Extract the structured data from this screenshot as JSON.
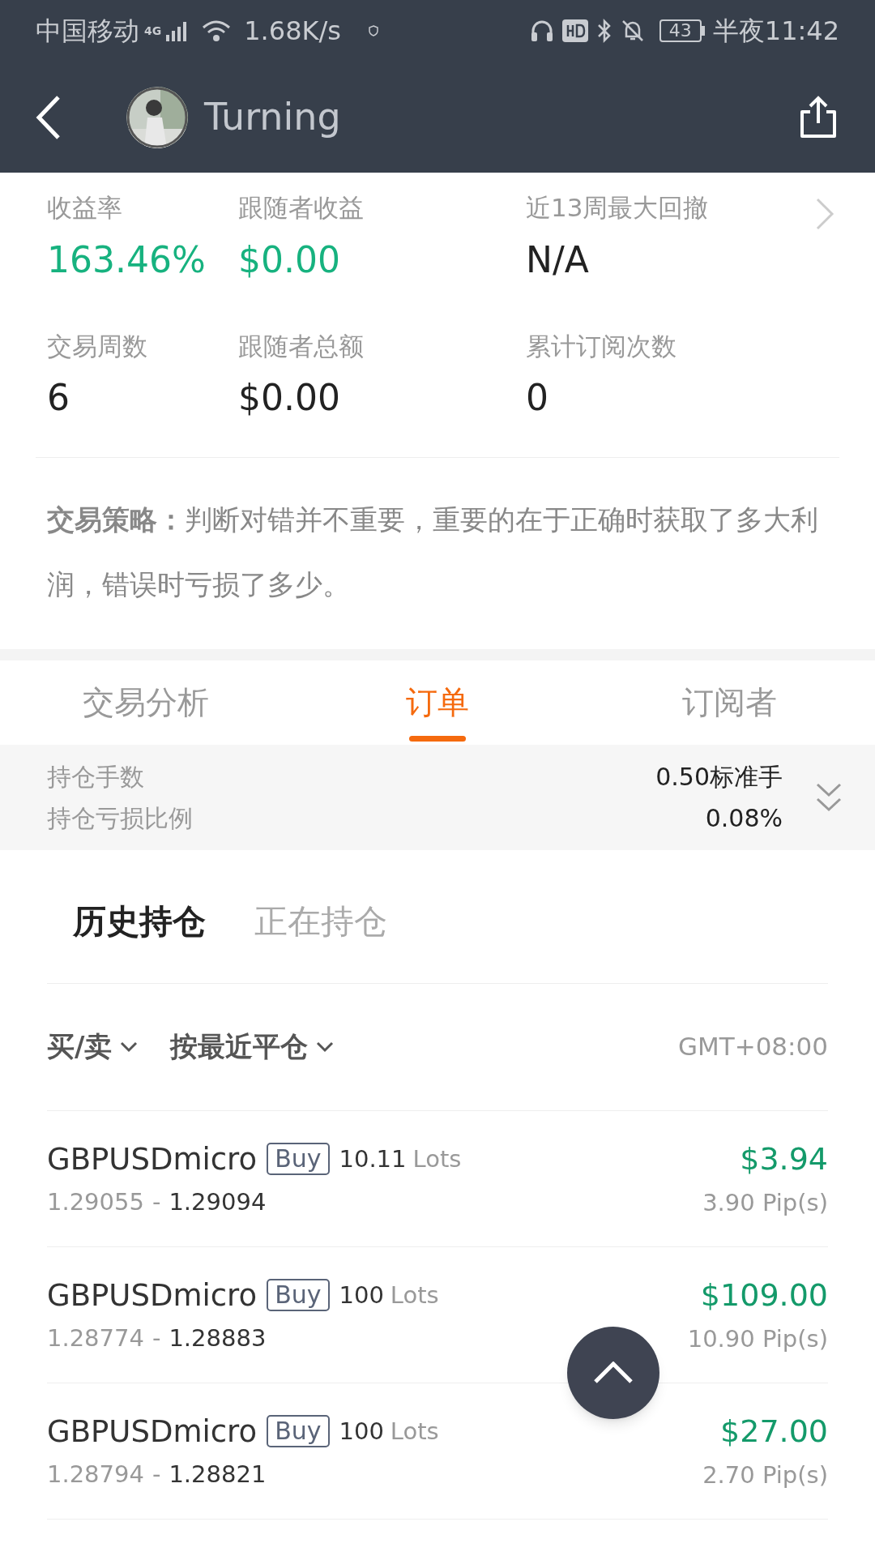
{
  "status_bar": {
    "carrier": "中国移动",
    "network": "4G",
    "speed": "1.68K/s",
    "battery": "43",
    "time": "半夜11:42"
  },
  "header": {
    "title": "Turning"
  },
  "stats": [
    {
      "label": "收益率",
      "value": "163.46%",
      "positive": true
    },
    {
      "label": "跟随者收益",
      "value": "$0.00",
      "positive": true
    },
    {
      "label": "近13周最大回撤",
      "value": "N/A",
      "positive": false
    },
    {
      "label": "交易周数",
      "value": "6",
      "positive": false
    },
    {
      "label": "跟随者总额",
      "value": "$0.00",
      "positive": false
    },
    {
      "label": "累计订阅次数",
      "value": "0",
      "positive": false
    }
  ],
  "strategy": "**交易策略：**判断对错并不重要，重要的在于正确时获取了多大利润，错误时亏损了多少。",
  "tabs": [
    {
      "label": "交易分析",
      "selected": false
    },
    {
      "label": "订单",
      "selected": true
    },
    {
      "label": "订阅者",
      "selected": false
    }
  ],
  "summary": [
    {
      "label": "持仓手数",
      "value": "0.50标准手"
    },
    {
      "label": "持仓亏损比例",
      "value": "0.08%"
    }
  ],
  "sub_tabs": [
    {
      "label": "历史持仓",
      "selected": true
    },
    {
      "label": "正在持仓",
      "selected": false
    }
  ],
  "filters": [
    {
      "label": "买/卖"
    },
    {
      "label": "按最近平仓"
    }
  ],
  "timezone": "GMT+08:00",
  "orders": [
    {
      "symbol": "GBPUSDmicro",
      "side": "Buy",
      "lots": "10.11",
      "lots_unit": "Lots",
      "open": "1.29055",
      "separator": "-",
      "close": "1.29094",
      "profit": "$3.94",
      "pips": "3.90 Pip(s)"
    },
    {
      "symbol": "GBPUSDmicro",
      "side": "Buy",
      "lots": "100",
      "lots_unit": "Lots",
      "open": "1.28774",
      "separator": "-",
      "close": "1.28883",
      "profit": "$109.00",
      "pips": "10.90 Pip(s)"
    },
    {
      "symbol": "GBPUSDmicro",
      "side": "Buy",
      "lots": "100",
      "lots_unit": "Lots",
      "open": "1.28794",
      "separator": "-",
      "close": "1.28821",
      "profit": "$27.00",
      "pips": "2.70 Pip(s)"
    }
  ]
}
